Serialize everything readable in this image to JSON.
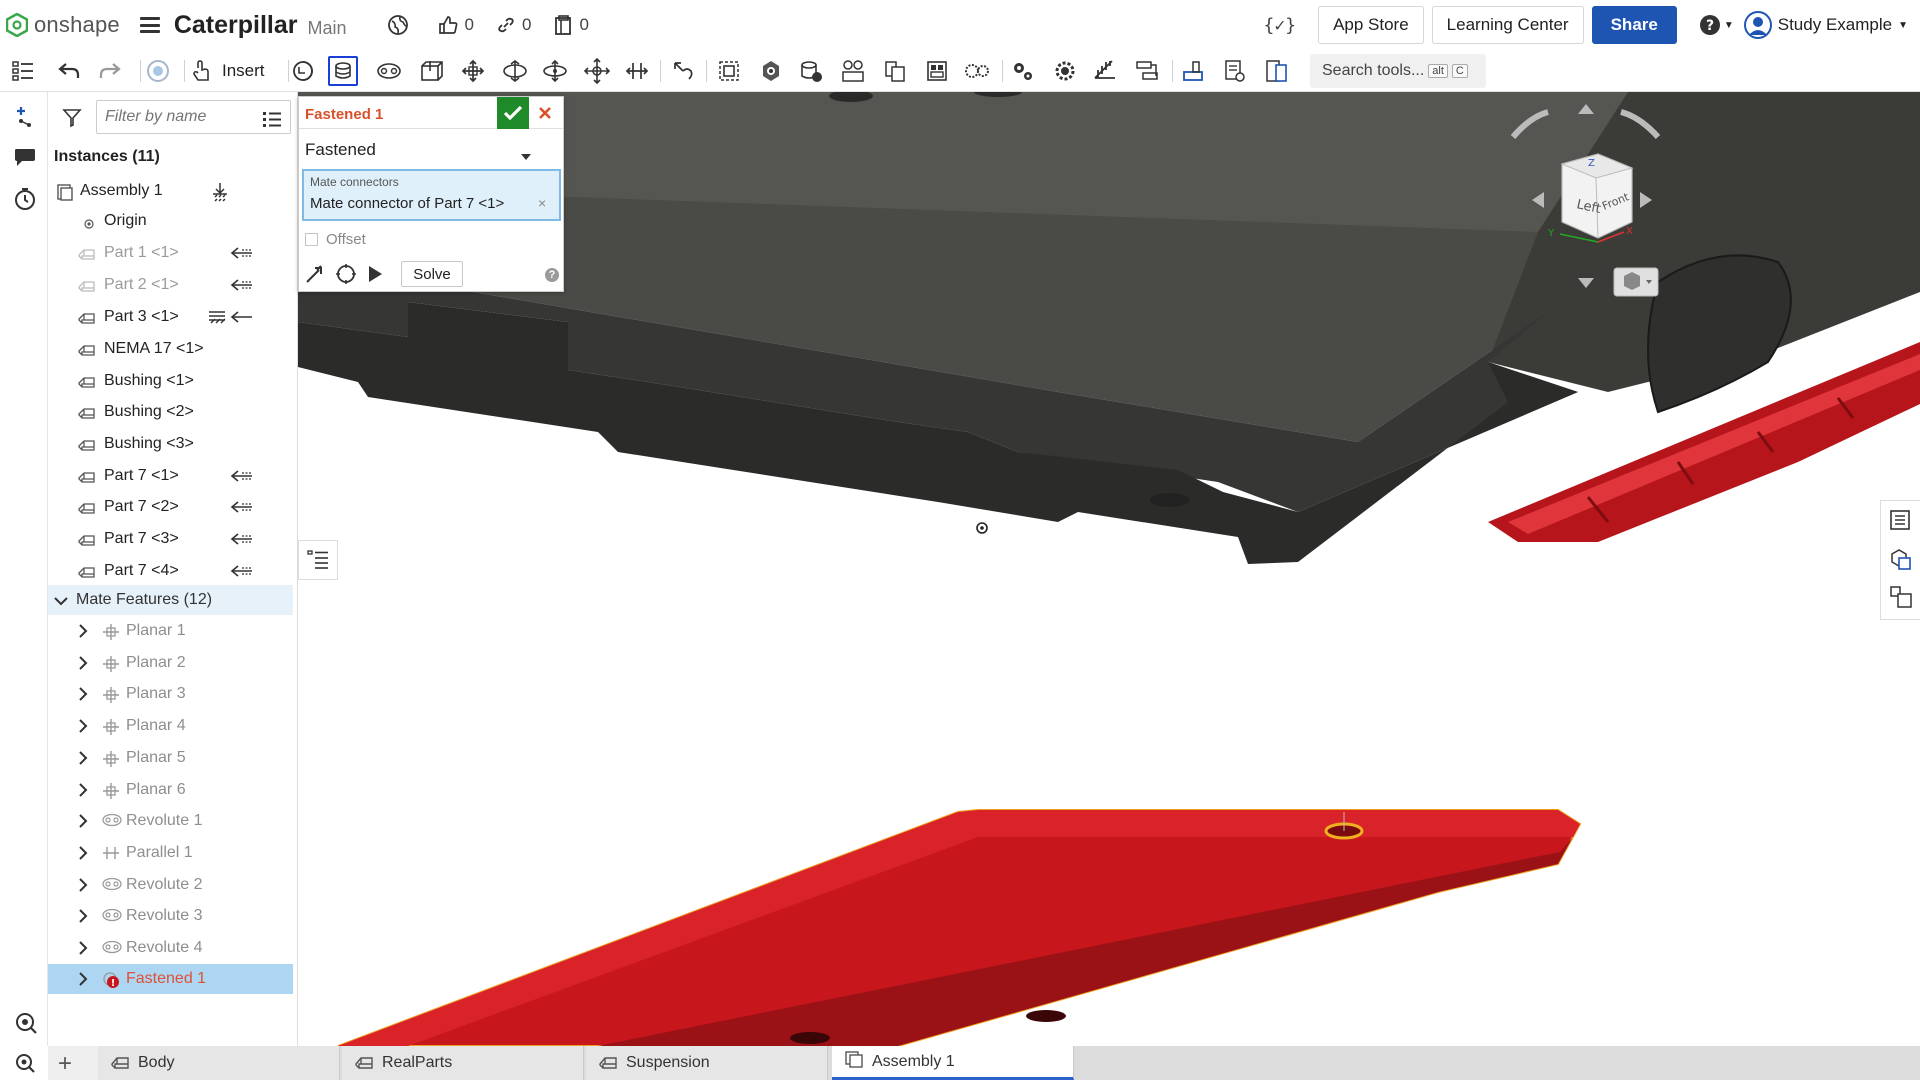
{
  "app": {
    "logo_text": "onshape",
    "doc_title": "Caterpillar",
    "branch": "Main"
  },
  "top_stats": {
    "likes": "0",
    "links": "0",
    "copies": "0"
  },
  "top_right": {
    "variables_icon": "variables-icon",
    "app_store": "App Store",
    "learning_center": "Learning Center",
    "share": "Share",
    "user": "Study Example"
  },
  "toolbar": {
    "insert_label": "Insert",
    "search_label": "Search tools...",
    "search_kbd_1": "alt",
    "search_kbd_2": "C"
  },
  "panel": {
    "filter_placeholder": "Filter by name",
    "instances_title": "Instances (11)",
    "instances": [
      {
        "label": "Assembly 1"
      },
      {
        "label": "Origin"
      },
      {
        "label": "Part 1 <1>"
      },
      {
        "label": "Part 2 <1>"
      },
      {
        "label": "Part 3 <1>"
      },
      {
        "label": "NEMA 17 <1>"
      },
      {
        "label": "Bushing <1>"
      },
      {
        "label": "Bushing <2>"
      },
      {
        "label": "Bushing <3>"
      },
      {
        "label": "Part 7 <1>"
      },
      {
        "label": "Part 7 <2>"
      },
      {
        "label": "Part 7 <3>"
      },
      {
        "label": "Part 7 <4>"
      }
    ],
    "mate_features_title": "Mate Features (12)",
    "mates": [
      {
        "label": "Planar 1",
        "icon": "planar-mate-icon"
      },
      {
        "label": "Planar 2",
        "icon": "planar-mate-icon"
      },
      {
        "label": "Planar 3",
        "icon": "planar-mate-icon"
      },
      {
        "label": "Planar 4",
        "icon": "planar-mate-icon"
      },
      {
        "label": "Planar 5",
        "icon": "planar-mate-icon"
      },
      {
        "label": "Planar 6",
        "icon": "planar-mate-icon"
      },
      {
        "label": "Revolute 1",
        "icon": "revolute-mate-icon"
      },
      {
        "label": "Parallel 1",
        "icon": "parallel-mate-icon"
      },
      {
        "label": "Revolute 2",
        "icon": "revolute-mate-icon"
      },
      {
        "label": "Revolute 3",
        "icon": "revolute-mate-icon"
      },
      {
        "label": "Revolute 4",
        "icon": "revolute-mate-icon"
      },
      {
        "label": "Fastened 1",
        "icon": "fastened-error-icon"
      }
    ]
  },
  "dialog": {
    "title": "Fastened 1",
    "mate_type": "Fastened",
    "connectors_caption": "Mate connectors",
    "connectors_value": "Mate connector of Part 7 <1>",
    "offset_label": "Offset",
    "solve_label": "Solve"
  },
  "view_cube": {
    "left": "Left",
    "front": "Front",
    "z": "Z",
    "x": "X",
    "y": "Y"
  },
  "tabs": [
    {
      "label": "Body"
    },
    {
      "label": "RealParts"
    },
    {
      "label": "Suspension"
    },
    {
      "label": "Assembly 1"
    }
  ],
  "colors": {
    "accent": "#1e55b3",
    "dialog_title": "#d9502b",
    "part_red": "#c8161d",
    "housing_dark": "#3a3a38",
    "selection": "#acd6f2",
    "ok_green": "#1f8a2a"
  }
}
